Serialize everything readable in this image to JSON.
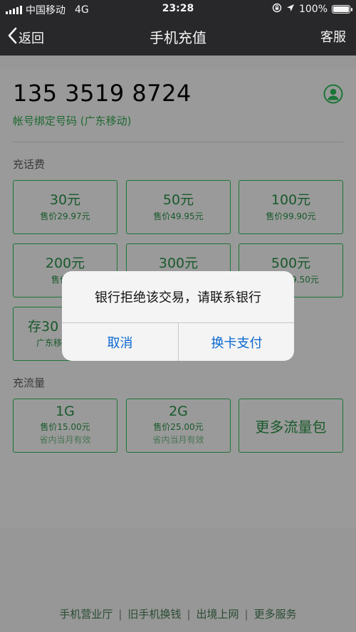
{
  "status": {
    "carrier": "中国移动",
    "network": "4G",
    "time": "23:28",
    "battery": "100%",
    "battery_level": 1.0
  },
  "nav": {
    "back_label": "返回",
    "title": "手机充值",
    "service_label": "客服"
  },
  "account": {
    "phone": "135 3519 8724",
    "binding": "帐号绑定号码 (广东移动)"
  },
  "recharge": {
    "label": "充话费",
    "tiles": [
      {
        "amount": "30元",
        "price": "售价29.97元"
      },
      {
        "amount": "50元",
        "price": "售价49.95元"
      },
      {
        "amount": "100元",
        "price": "售价99.90元"
      },
      {
        "amount": "200元",
        "price": "售价19"
      },
      {
        "amount": "300元",
        "price": ""
      },
      {
        "amount": "500元",
        "price": "9.50元"
      },
      {
        "amount": "存30",
        "price": "广东移"
      }
    ]
  },
  "data_plan": {
    "label": "充流量",
    "tiles": [
      {
        "amount": "1G",
        "price": "售价15.00元",
        "note": "省内当月有效"
      },
      {
        "amount": "2G",
        "price": "售价25.00元",
        "note": "省内当月有效"
      }
    ],
    "more_label": "更多流量包"
  },
  "footer": {
    "links": [
      "手机营业厅",
      "旧手机换钱",
      "出境上网",
      "更多服务"
    ]
  },
  "dialog": {
    "message": "银行拒绝该交易，请联系银行",
    "cancel_label": "取消",
    "confirm_label": "换卡支付"
  },
  "colors": {
    "accent_green": "#1e7a3a",
    "dialog_button": "#0a68d1",
    "nav_bg": "#2a2a2c"
  }
}
